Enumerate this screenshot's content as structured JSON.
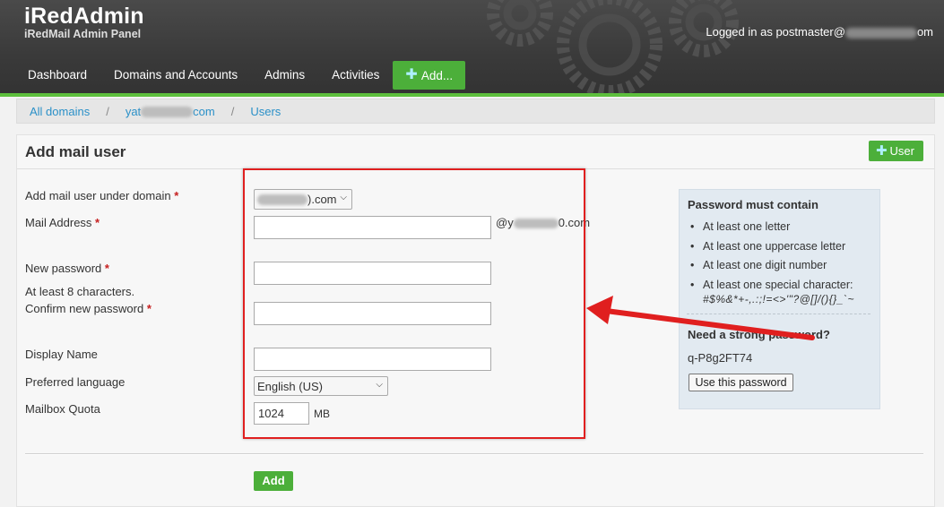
{
  "header": {
    "app_title": "iRedAdmin",
    "app_subtitle": "iRedMail Admin Panel",
    "logged_in_prefix": "Logged in as postmaster@",
    "logged_in_suffix": "om"
  },
  "nav": {
    "items": [
      "Dashboard",
      "Domains and Accounts",
      "Admins",
      "Activities"
    ],
    "add_label": "Add..."
  },
  "breadcrumb": {
    "all_domains": "All domains",
    "separator": "/",
    "domain_prefix": "yat",
    "domain_suffix": "com",
    "users": "Users"
  },
  "form": {
    "title": "Add mail user",
    "user_button": "User",
    "domain_label": "Add mail user under domain",
    "domain_value_suffix": ").com",
    "mail_address_label": "Mail Address",
    "at_domain_prefix": "@y",
    "at_domain_suffix": "0.com",
    "new_password_label": "New password",
    "password_hint": "At least 8 characters.",
    "confirm_password_label": "Confirm new password",
    "display_name_label": "Display Name",
    "language_label": "Preferred language",
    "language_value": "English (US)",
    "quota_label": "Mailbox Quota",
    "quota_value": "1024",
    "quota_unit": "MB",
    "required_mark": "*",
    "submit_label": "Add"
  },
  "password_rules": {
    "title": "Password must contain",
    "rules": [
      "At least one letter",
      "At least one uppercase letter",
      "At least one digit number",
      "At least one special character:"
    ],
    "special_chars": "#$%&*+-,.:;!=<>'\"?@[]/(){}_`~",
    "strong_prompt": "Need a strong password?",
    "suggested_password": "q-P8g2FT74",
    "use_button": "Use this password"
  },
  "colors": {
    "accent_green": "#4caf3a",
    "highlight_red": "#e01f1f",
    "link_blue": "#2a90c8"
  }
}
